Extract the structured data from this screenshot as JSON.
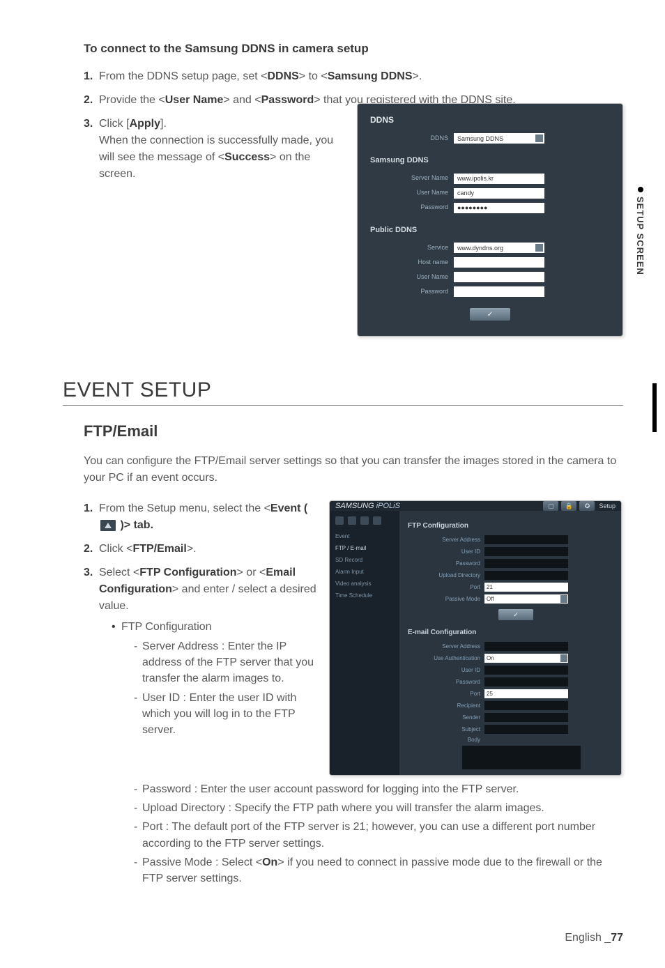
{
  "section_ddns_connect": {
    "heading": "To connect to the Samsung DDNS in camera setup",
    "steps": [
      {
        "num": "1.",
        "pre": "From the DDNS setup page, set <",
        "b1": "DDNS",
        "mid": "> to <",
        "b2": "Samsung DDNS",
        "post": ">."
      },
      {
        "num": "2.",
        "pre": "Provide the <",
        "b1": "User Name",
        "mid": "> and <",
        "b2": "Password",
        "post": "> that you registered with the DDNS site."
      },
      {
        "num": "3.",
        "pre": "Click [",
        "b1": "Apply",
        "post_line1": "].",
        "line2a": "When the connection is successfully made, you will see the message of <",
        "line2b": "Success",
        "line2c": "> on the screen."
      }
    ]
  },
  "screenshot_ddns": {
    "title": "DDNS",
    "top_label": "DDNS",
    "top_value": "Samsung DDNS",
    "section1": "Samsung DDNS",
    "server_name_label": "Server Name",
    "server_name_value": "www.ipolis.kr",
    "user_name_label": "User Name",
    "user_name_value": "candy",
    "password_label": "Password",
    "password_value": "●●●●●●●●",
    "section2": "Public DDNS",
    "service_label": "Service",
    "service_value": "www.dyndns.org",
    "host_name_label": "Host name",
    "host_name_value": "",
    "p_user_label": "User Name",
    "p_user_value": "",
    "p_pass_label": "Password",
    "p_pass_value": "",
    "apply": "✓"
  },
  "side_tab": "SETUP SCREEN",
  "event_setup": {
    "h1": "EVENT SETUP",
    "h2": "FTP/Email",
    "intro": "You can configure the FTP/Email server settings so that you can transfer the images stored in the camera to your PC if an event occurs.",
    "steps": {
      "s1": {
        "num": "1.",
        "pre": "From the Setup menu, select the <",
        "b": "Event ( ",
        "post": " )> tab."
      },
      "s2": {
        "num": "2.",
        "pre": "Click <",
        "b": "FTP/Email",
        "post": ">."
      },
      "s3": {
        "num": "3.",
        "pre": "Select <",
        "b1": "FTP Configuration",
        "mid": "> or <",
        "b2": "Email Configuration",
        "post": "> and enter / select a desired value."
      }
    },
    "bullet": "FTP Configuration",
    "dashes_left": [
      "Server Address : Enter the IP address of the FTP server that you transfer the alarm images to.",
      "User ID : Enter the user ID with which you will log in to the FTP server."
    ],
    "dashes_full": [
      "Password : Enter the user account password for logging into the FTP server.",
      "Upload Directory : Specify the FTP path where you will transfer the alarm images.",
      "Port : The default port of the FTP server is 21; however, you can use a different port number according to the FTP server settings.",
      "Passive Mode : Select <On> if you need to connect in passive mode due to the firewall or the FTP server settings."
    ],
    "passive_bold": "On"
  },
  "screenshot_ftp": {
    "brand1": "SAMSUNG ",
    "brand2": "iPOLiS",
    "top_btns": [
      "▢",
      "🔒",
      "✪"
    ],
    "top_setup": "Setup",
    "nav": [
      {
        "label": "Event",
        "sub": true
      },
      {
        "label": "FTP / E-mail",
        "active": true
      },
      {
        "label": "SD Record"
      },
      {
        "label": "Alarm Input"
      },
      {
        "label": "Video analysis"
      },
      {
        "label": "Time Schedule"
      }
    ],
    "ftp_section": "FTP Configuration",
    "ftp_rows": {
      "server": "Server Address",
      "user": "User ID",
      "pass": "Password",
      "upload": "Upload Directory",
      "port": "Port",
      "port_val": "21",
      "passive": "Passive Mode",
      "passive_val": "Off"
    },
    "apply": "✓",
    "email_section": "E-mail Configuration",
    "email_rows": {
      "server": "Server Address",
      "auth": "Use Authentication",
      "auth_val": "On",
      "user": "User ID",
      "pass": "Password",
      "port": "Port",
      "port_val": "25",
      "recipient": "Recipient",
      "sender": "Sender",
      "subject": "Subject",
      "body": "Body"
    }
  },
  "footer": {
    "lang": "English _",
    "page": "77"
  }
}
